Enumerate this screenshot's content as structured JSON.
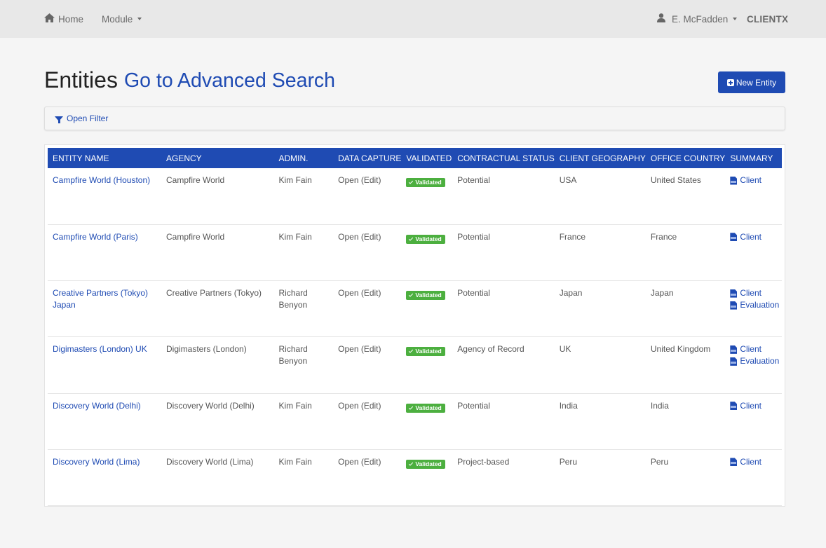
{
  "navbar": {
    "home_label": "Home",
    "module_label": "Module",
    "user_label": "E. McFadden",
    "brand_label": "CLIENTX"
  },
  "page": {
    "title": "Entities",
    "advanced_search_link": "Go to Advanced Search",
    "new_entity_label": "New Entity",
    "open_filter_label": "Open Filter"
  },
  "colors": {
    "accent": "#1f4bb3",
    "validated_badge": "#4caf3f",
    "navbar_bg": "#e8e8e8"
  },
  "table": {
    "columns": [
      "ENTITY NAME",
      "AGENCY",
      "ADMIN.",
      "DATA CAPTURE",
      "VALIDATED",
      "CONTRACTUAL STATUS",
      "CLIENT GEOGRAPHY",
      "OFFICE COUNTRY",
      "SUMMARY"
    ],
    "rows": [
      {
        "entity_name": "Campfire World (Houston)",
        "agency": "Campfire World",
        "admin": "Kim Fain",
        "data_capture": "Open (Edit)",
        "validated": "Validated",
        "contractual_status": "Potential",
        "client_geography": "USA",
        "office_country": "United States",
        "summary": [
          "Client"
        ]
      },
      {
        "entity_name": "Campfire World (Paris)",
        "agency": "Campfire World",
        "admin": "Kim Fain",
        "data_capture": "Open (Edit)",
        "validated": "Validated",
        "contractual_status": "Potential",
        "client_geography": "France",
        "office_country": "France",
        "summary": [
          "Client"
        ]
      },
      {
        "entity_name": "Creative Partners (Tokyo) Japan",
        "agency": "Creative Partners (Tokyo)",
        "admin": "Richard Benyon",
        "data_capture": "Open (Edit)",
        "validated": "Validated",
        "contractual_status": "Potential",
        "client_geography": "Japan",
        "office_country": "Japan",
        "summary": [
          "Client",
          "Evaluation"
        ]
      },
      {
        "entity_name": "Digimasters (London) UK",
        "agency": "Digimasters (London)",
        "admin": "Richard Benyon",
        "data_capture": "Open (Edit)",
        "validated": "Validated",
        "contractual_status": "Agency of Record",
        "client_geography": "UK",
        "office_country": "United Kingdom",
        "summary": [
          "Client",
          "Evaluation"
        ]
      },
      {
        "entity_name": "Discovery World (Delhi)",
        "agency": "Discovery World (Delhi)",
        "admin": "Kim Fain",
        "data_capture": "Open (Edit)",
        "validated": "Validated",
        "contractual_status": "Potential",
        "client_geography": "India",
        "office_country": "India",
        "summary": [
          "Client"
        ]
      },
      {
        "entity_name": "Discovery World (Lima)",
        "agency": "Discovery World (Lima)",
        "admin": "Kim Fain",
        "data_capture": "Open (Edit)",
        "validated": "Validated",
        "contractual_status": "Project-based",
        "client_geography": "Peru",
        "office_country": "Peru",
        "summary": [
          "Client"
        ]
      }
    ]
  }
}
